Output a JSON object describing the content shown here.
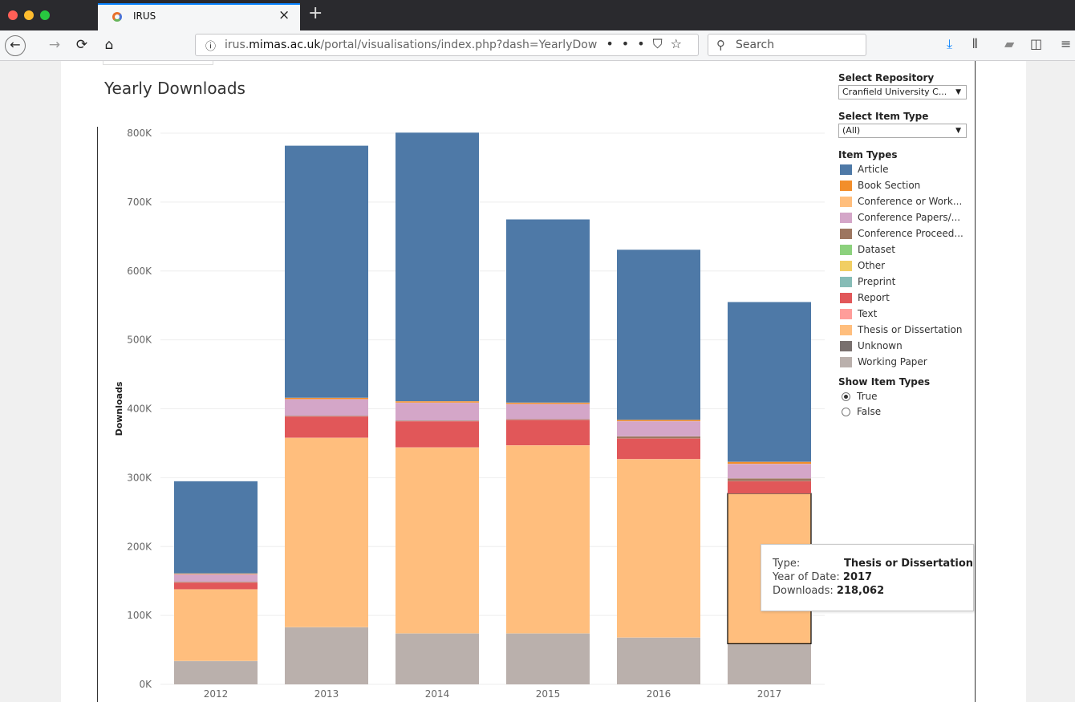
{
  "browser": {
    "tab_title": "IRUS",
    "tab_close": "×",
    "new_tab": "+",
    "url_prefix": "irus.",
    "url_domain": "mimas.ac.uk",
    "url_suffix": "/portal/visualisations/index.php?dash=YearlyDow",
    "url_more": "•••",
    "search_placeholder": "Search"
  },
  "viz": {
    "title": "Yearly Downloads",
    "ylabel": "Downloads"
  },
  "filters": {
    "repository_label": "Select Repository",
    "repository_value": "Cranfield University C...",
    "item_type_label": "Select Item Type",
    "item_type_value": "(All)",
    "legend_title": "Item Types",
    "show_label": "Show Item Types",
    "show_true": "True",
    "show_false": "False"
  },
  "legend": [
    {
      "label": "Article",
      "color": "#4e79a7"
    },
    {
      "label": "Book Section",
      "color": "#f28e2b"
    },
    {
      "label": "Conference or Work...",
      "color": "#ffbe7d"
    },
    {
      "label": "Conference Papers/...",
      "color": "#d4a6c8"
    },
    {
      "label": "Conference Proceed...",
      "color": "#9d7660"
    },
    {
      "label": "Dataset",
      "color": "#8cd17d"
    },
    {
      "label": "Other",
      "color": "#f1ce63"
    },
    {
      "label": "Preprint",
      "color": "#86bcb6"
    },
    {
      "label": "Report",
      "color": "#e15759"
    },
    {
      "label": "Text",
      "color": "#ff9d9a"
    },
    {
      "label": "Thesis or Dissertation",
      "color": "#ffbe7d"
    },
    {
      "label": "Unknown",
      "color": "#79706e"
    },
    {
      "label": "Working Paper",
      "color": "#bab0ac"
    }
  ],
  "tooltip": {
    "type_label": "Type:",
    "type_value": "Thesis or Dissertation",
    "year_label": "Year of Date:",
    "year_value": "2017",
    "downloads_label": "Downloads:",
    "downloads_value": "218,062"
  },
  "chart_data": {
    "type": "bar",
    "stacked": true,
    "categories": [
      "2012",
      "2013",
      "2014",
      "2015",
      "2016",
      "2017"
    ],
    "ylim": [
      0,
      800000
    ],
    "yticks": [
      "0K",
      "100K",
      "200K",
      "300K",
      "400K",
      "500K",
      "600K",
      "700K",
      "800K"
    ],
    "ylabel": "Downloads",
    "highlight": {
      "category": "2017",
      "series": "Thesis or Dissertation"
    },
    "series": [
      {
        "name": "Working Paper",
        "color": "#bab0ac",
        "values": [
          34000,
          83000,
          74000,
          74000,
          68000,
          59000
        ]
      },
      {
        "name": "Thesis or Dissertation",
        "color": "#ffbe7d",
        "values": [
          104000,
          275000,
          270000,
          273000,
          259000,
          218062
        ]
      },
      {
        "name": "Report",
        "color": "#e15759",
        "values": [
          10000,
          31000,
          38000,
          37000,
          30000,
          18000
        ]
      },
      {
        "name": "Conference Proceed...",
        "color": "#9d7660",
        "values": [
          1000,
          1000,
          1000,
          1000,
          3000,
          4000
        ]
      },
      {
        "name": "Conference Papers/...",
        "color": "#d4a6c8",
        "values": [
          11000,
          24000,
          26000,
          22000,
          22000,
          21000
        ]
      },
      {
        "name": "Book Section",
        "color": "#f28e2b",
        "values": [
          1000,
          2000,
          2000,
          2000,
          2000,
          3000
        ]
      },
      {
        "name": "Article",
        "color": "#4e79a7",
        "values": [
          134000,
          366000,
          390000,
          266000,
          247000,
          232000
        ]
      }
    ]
  }
}
